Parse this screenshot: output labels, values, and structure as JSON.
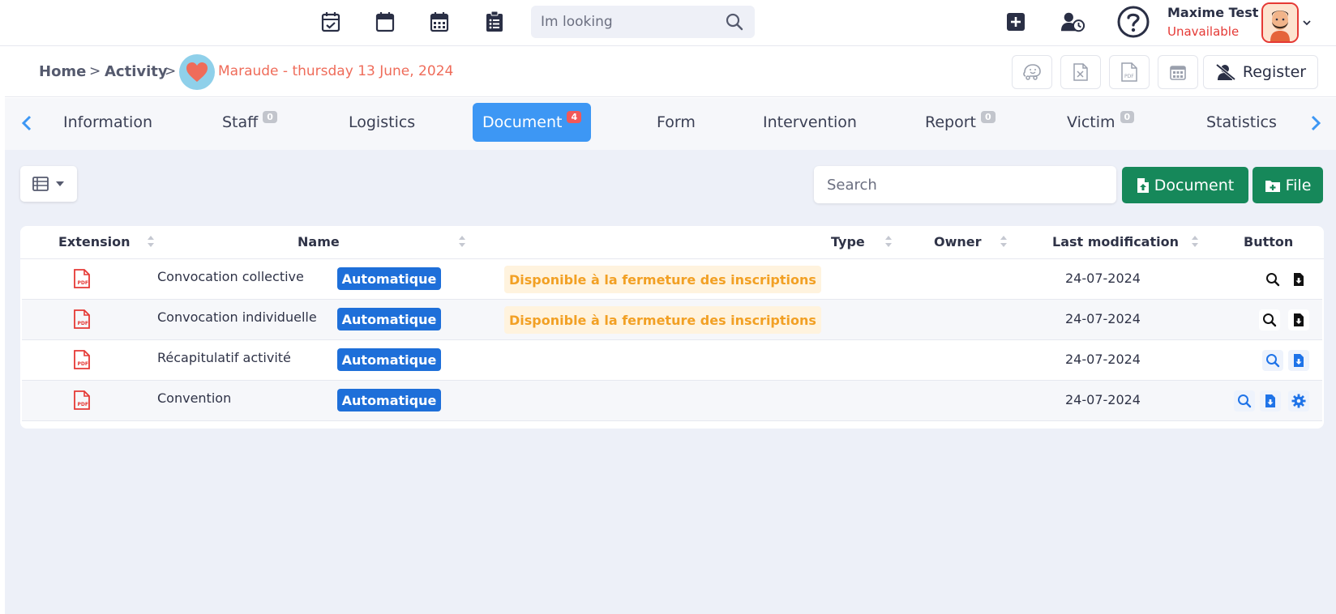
{
  "topbar": {
    "icons": [
      "calendar-check-icon",
      "calendar-icon",
      "calendar-grid-icon",
      "clipboard-list-icon"
    ],
    "search_placeholder": "Im looking",
    "user": {
      "name": "Maxime Test",
      "status": "Unavailable"
    }
  },
  "breadcrumb": {
    "home": "Home",
    "activity": "Activity",
    "separator": ">",
    "current": "Maraude - thursday 13 June, 2024"
  },
  "actions": {
    "register_label": "Register"
  },
  "tabs": [
    {
      "label": "Information",
      "badge": ""
    },
    {
      "label": "Staff",
      "badge": "0"
    },
    {
      "label": "Logistics",
      "badge": ""
    },
    {
      "label": "Document",
      "badge": "4",
      "active": true
    },
    {
      "label": "Form",
      "badge": ""
    },
    {
      "label": "Intervention",
      "badge": ""
    },
    {
      "label": "Report",
      "badge": "0"
    },
    {
      "label": "Victim",
      "badge": "0"
    },
    {
      "label": "Statistics",
      "badge": ""
    }
  ],
  "toolbar": {
    "search_placeholder": "Search",
    "add_document_label": "Document",
    "add_file_label": "File"
  },
  "table": {
    "columns": {
      "extension": "Extension",
      "name": "Name",
      "type": "Type",
      "owner": "Owner",
      "last_modification": "Last modification",
      "button": "Button"
    },
    "rows": [
      {
        "name": "Convocation collective",
        "tag": "Automatique",
        "availability": "Disponible à la fermeture des inscriptions",
        "date": "24-07-2024"
      },
      {
        "name": "Convocation individuelle",
        "tag": "Automatique",
        "availability": "Disponible à la fermeture des inscriptions",
        "date": "24-07-2024"
      },
      {
        "name": "Récapitulatif activité",
        "tag": "Automatique",
        "availability": "",
        "date": "24-07-2024"
      },
      {
        "name": "Convention",
        "tag": "Automatique",
        "availability": "",
        "date": "24-07-2024"
      }
    ]
  },
  "colors": {
    "accent_blue": "#3d97f4",
    "green": "#16885a",
    "danger": "#e53935",
    "badge_blue": "#1e6fd9",
    "warning": "#f2a024",
    "pdf_red": "#e53935"
  }
}
